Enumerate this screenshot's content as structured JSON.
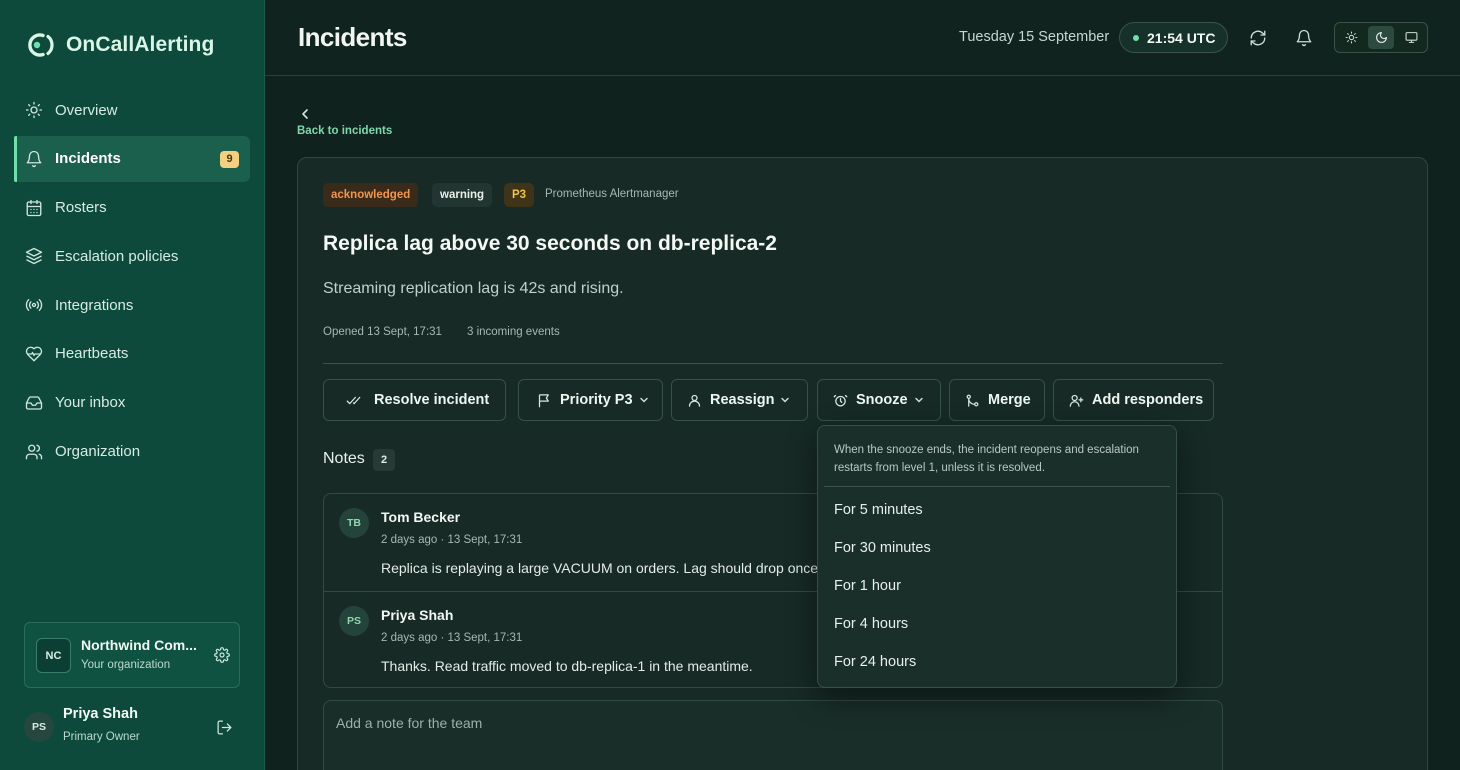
{
  "app": {
    "name": "OnCallAlerting"
  },
  "sidebar": {
    "items": [
      {
        "label": "Overview",
        "icon": "sun-icon"
      },
      {
        "label": "Incidents",
        "icon": "bell-icon",
        "badge": "9",
        "active": true
      },
      {
        "label": "Rosters",
        "icon": "calendar-icon"
      },
      {
        "label": "Escalation policies",
        "icon": "layers-icon"
      },
      {
        "label": "Integrations",
        "icon": "broadcast-icon"
      },
      {
        "label": "Heartbeats",
        "icon": "heart-pulse-icon"
      },
      {
        "label": "Your inbox",
        "icon": "inbox-icon"
      },
      {
        "label": "Organization",
        "icon": "users-icon"
      }
    ],
    "org": {
      "initials": "NC",
      "name": "Northwind Com...",
      "subtitle": "Your organization"
    },
    "user": {
      "initials": "PS",
      "name": "Priya Shah",
      "role": "Primary Owner"
    }
  },
  "topbar": {
    "title": "Incidents",
    "date": "Tuesday 15 September",
    "time": "21:54 UTC",
    "theme_modes": [
      "light",
      "dark",
      "system"
    ],
    "theme_selected": "dark"
  },
  "incident": {
    "back_label": "Back to incidents",
    "status": "acknowledged",
    "severity": "warning",
    "priority": "P3",
    "source": "Prometheus Alertmanager",
    "title": "Replica lag above 30 seconds on db-replica-2",
    "description": "Streaming replication lag is 42s and rising.",
    "opened": "Opened 13 Sept, 17:31",
    "events": "3 incoming events",
    "actions": {
      "resolve": "Resolve incident",
      "priority": "Priority P3",
      "reassign": "Reassign",
      "snooze": "Snooze",
      "merge": "Merge",
      "add_responders": "Add responders"
    }
  },
  "notes": {
    "label": "Notes",
    "count": "2",
    "items": [
      {
        "initials": "TB",
        "author": "Tom Becker",
        "time": "2 days ago · 13 Sept, 17:31",
        "text": "Replica is replaying a large VACUUM on orders. Lag should drop once"
      },
      {
        "initials": "PS",
        "author": "Priya Shah",
        "time": "2 days ago · 13 Sept, 17:31",
        "text": "Thanks. Read traffic moved to db-replica-1 in the meantime."
      }
    ],
    "input_placeholder": "Add a note for the team"
  },
  "snooze_menu": {
    "hint": "When the snooze ends, the incident reopens and escalation restarts from level 1, unless it is resolved.",
    "options": [
      "For 5 minutes",
      "For 30 minutes",
      "For 1 hour",
      "For 4 hours",
      "For 24 hours"
    ]
  },
  "colors": {
    "sidebar_bg": "#0d4a3b",
    "accent": "#6fe0ab",
    "status_acknowledged": "#f2964f",
    "priority_p3": "#f0c14e",
    "badge": "#f3cf82"
  }
}
